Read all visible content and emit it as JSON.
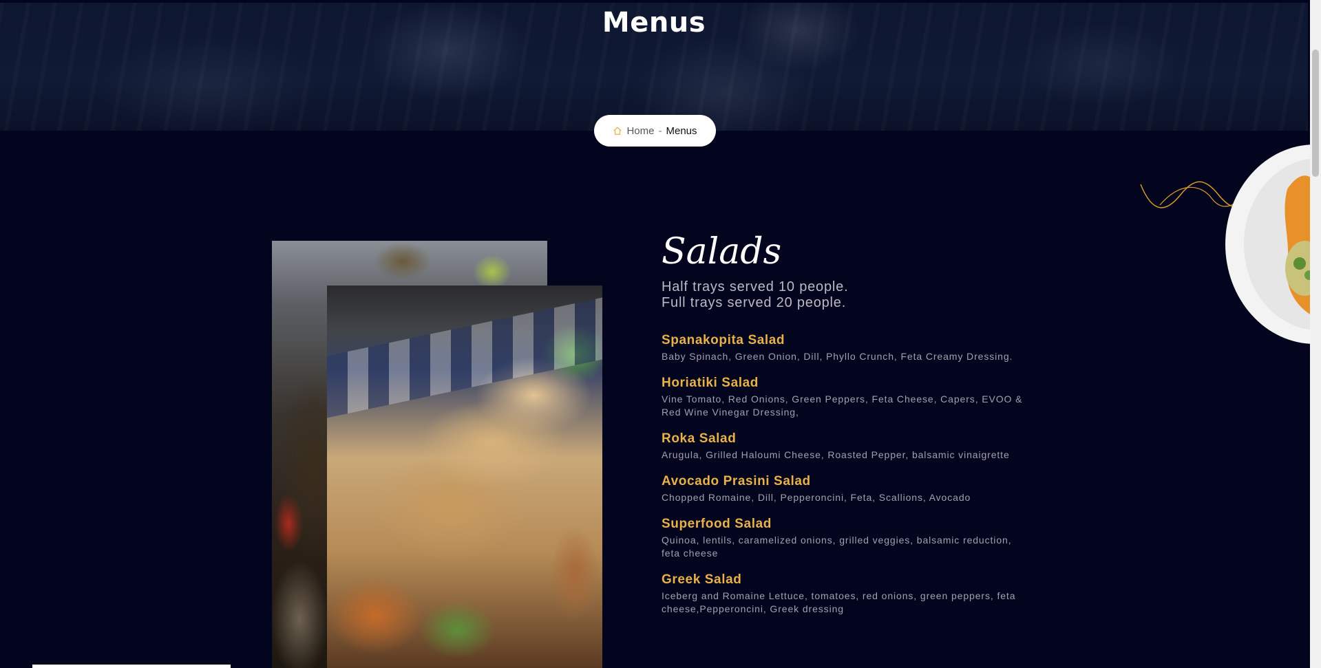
{
  "hero": {
    "title": "Menus"
  },
  "breadcrumb": {
    "home_label": "Home",
    "separator": "-",
    "current_label": "Menus",
    "home_icon": "home-icon"
  },
  "colors": {
    "background": "#03041e",
    "accent": "#e8b14a",
    "squiggle": "#d99a2b"
  },
  "section": {
    "title": "Salads",
    "intro": [
      "Half trays served 10 people.",
      "Full trays served 20 people."
    ],
    "items": [
      {
        "name": "Spanakopita Salad",
        "description": "Baby Spinach, Green Onion, Dill, Phyllo Crunch, Feta Creamy Dressing."
      },
      {
        "name": "Horiatiki Salad",
        "description": "Vine Tomato, Red Onions, Green Peppers, Feta Cheese, Capers, EVOO & Red Wine Vinegar Dressing,"
      },
      {
        "name": "Roka Salad",
        "description": "Arugula, Grilled Haloumi Cheese, Roasted Pepper, balsamic vinaigrette"
      },
      {
        "name": "Avocado Prasini Salad",
        "description": "Chopped Romaine, Dill, Pepperoncini, Feta, Scallions, Avocado"
      },
      {
        "name": "Superfood Salad",
        "description": "Quinoa, lentils, caramelized onions, grilled veggies, balsamic reduction, feta cheese"
      },
      {
        "name": "Greek Salad",
        "description": "Iceberg and Romaine Lettuce, tomatoes, red onions, green peppers, feta cheese,Pepperoncini, Greek dressing"
      }
    ]
  }
}
